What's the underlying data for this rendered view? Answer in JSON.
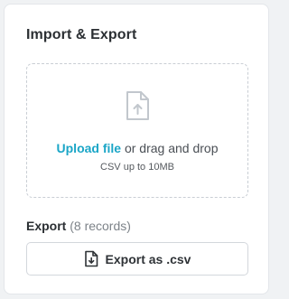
{
  "panel": {
    "title": "Import & Export"
  },
  "import": {
    "upload_link": "Upload file",
    "upload_rest": " or drag and drop",
    "hint": "CSV up to 10MB",
    "icon": "file-upload-icon"
  },
  "export": {
    "label": "Export",
    "count_text": "(8 records)",
    "button_label": "Export as .csv",
    "button_icon": "file-download-icon"
  },
  "colors": {
    "accent": "#1ba6c7",
    "text": "#2b2f33",
    "muted": "#7d8389",
    "border": "#d3d7dc"
  }
}
